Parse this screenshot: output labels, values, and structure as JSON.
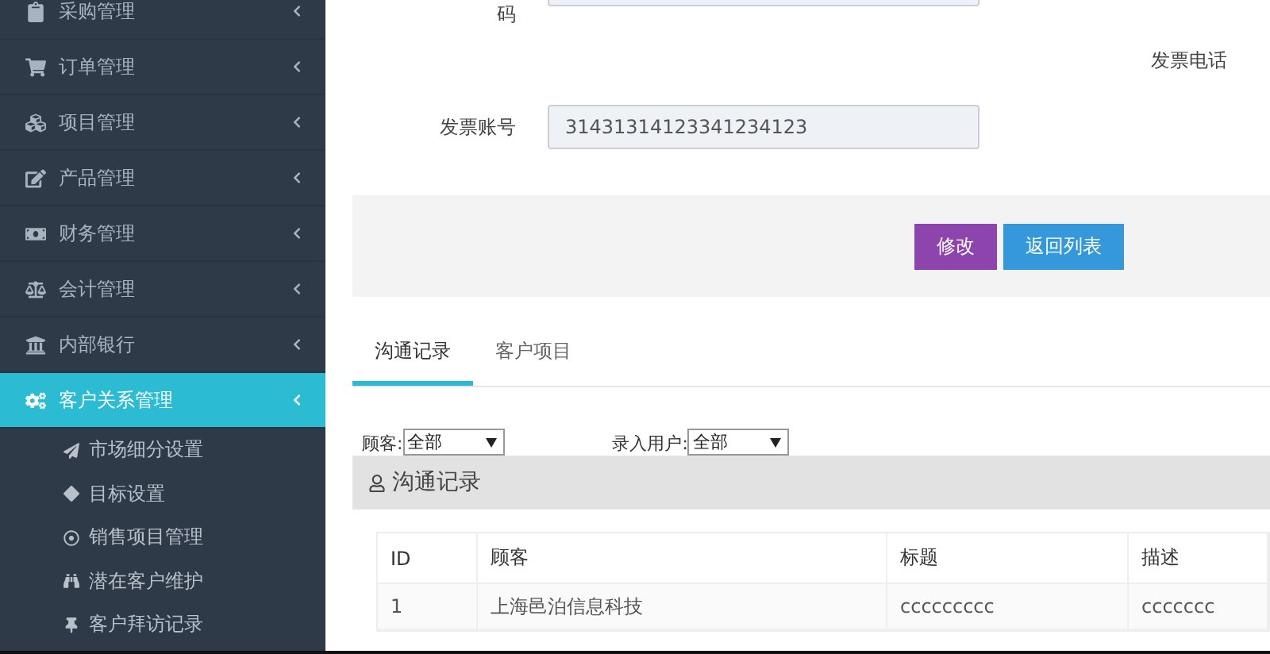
{
  "sidebar": {
    "items": [
      {
        "label": "采购管理",
        "selected": false
      },
      {
        "label": "订单管理",
        "selected": false
      },
      {
        "label": "项目管理",
        "selected": false
      },
      {
        "label": "产品管理",
        "selected": false
      },
      {
        "label": "财务管理",
        "selected": false
      },
      {
        "label": "会计管理",
        "selected": false
      },
      {
        "label": "内部银行",
        "selected": false
      },
      {
        "label": "客户关系管理",
        "selected": true,
        "children": [
          {
            "label": "市场细分设置"
          },
          {
            "label": "目标设置"
          },
          {
            "label": "销售项目管理"
          },
          {
            "label": "潜在客户维护"
          },
          {
            "label": "客户拜访记录"
          }
        ]
      }
    ]
  },
  "form": {
    "fields": [
      {
        "label": "码"
      },
      {
        "label": "发票账号",
        "value": "31431314123341234123"
      }
    ],
    "side_label": "发票电话"
  },
  "actions": [
    {
      "label": "修改",
      "kind": "edit"
    },
    {
      "label": "返回列表",
      "kind": "back"
    }
  ],
  "tabs": [
    {
      "label": "沟通记录",
      "selected": true
    },
    {
      "label": "客户项目",
      "selected": false
    }
  ],
  "filters": [
    {
      "label": "顾客:",
      "value": "全部"
    },
    {
      "label": "录入用户:",
      "value": "全部"
    }
  ],
  "panel": {
    "title": "沟通记录"
  },
  "table": {
    "columns": [
      "ID",
      "顾客",
      "标题",
      "描述"
    ],
    "rows": [
      [
        "1",
        "上海邑泊信息科技",
        "ccccccccc",
        "ccccccc"
      ]
    ]
  }
}
